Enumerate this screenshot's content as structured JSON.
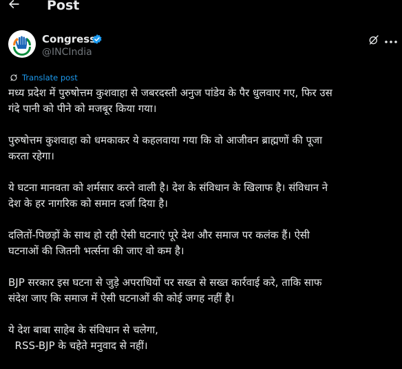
{
  "header": {
    "title": "Post",
    "back_icon": "arrow-left-icon"
  },
  "author": {
    "name": "Congress",
    "handle": "@INCIndia",
    "verified_color": "#1d9bf0",
    "avatar_icon": "congress-hand-logo"
  },
  "translate_label": "Translate post",
  "accent_color": "#1d9bf0",
  "post": {
    "paragraphs": [
      {
        "lines": [
          "मध्य प्रदेश में पुरुषोत्तम कुशवाहा से जबरदस्ती अनुज पांडेय के पैर धुलवाए गए, फिर उस",
          "गंदे पानी को पीने को मजबूर किया गया।"
        ]
      },
      {
        "lines": [
          "पुरुषोत्तम कुशवाहा को धमकाकर ये कहलवाया गया कि वो आजीवन ब्राह्मणों की पूजा",
          "करता रहेगा।"
        ]
      },
      {
        "lines": [
          "ये घटना मानवता को शर्मसार करने वाली है। देश के संविधान के खिलाफ है। संविधान ने",
          "देश के हर नागरिक को समान दर्जा दिया है।"
        ]
      },
      {
        "lines": [
          "दलितों-पिछड़ों के साथ हो रही ऐसी घटनाएं पूरे देश और समाज पर कलंक हैं। ऐसी",
          "घटनाओं की जितनी भर्त्सना की जाए वो कम है।"
        ]
      },
      {
        "lines": [
          "BJP सरकार इस घटना से जुड़े अपराधियों पर सख्त से सख्त कार्रवाई करे, ताकि साफ",
          "संदेश जाए कि समाज में ऐसी घटनाओं की कोई जगह नहीं है।"
        ]
      },
      {
        "lines": [
          "ये देश बाबा साहेब के संविधान से चलेगा,",
          "  RSS-BJP के चहेते मनुवाद से नहीं।"
        ]
      }
    ]
  }
}
